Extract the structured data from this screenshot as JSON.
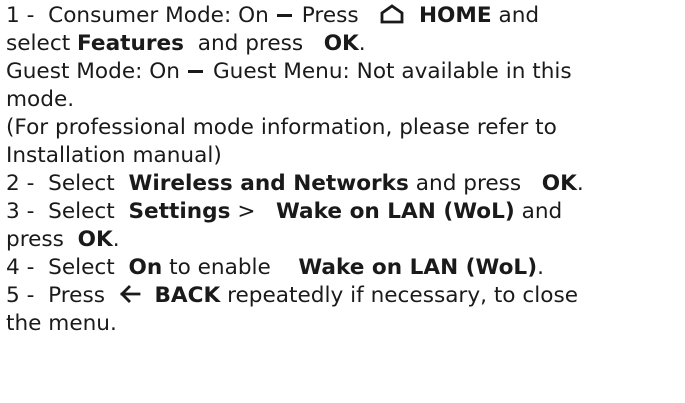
{
  "lines": [
    {
      "step": "1 -",
      "t1": "Consumer Mode: On",
      "t2": "Press",
      "home_icon": "home-icon",
      "home": "HOME",
      "t3": "and"
    },
    {
      "t1": "select",
      "features": "Features",
      "t2": "and press",
      "ok": "OK",
      "t3": "."
    },
    {
      "t1": "Guest Mode: On",
      "t2": "Guest Menu: Not available in this"
    },
    {
      "t1": "mode."
    },
    {
      "t1": "(For professional mode information, please refer to"
    },
    {
      "t1": "Installation manual)"
    },
    {
      "step": "2 -",
      "t1": "Select",
      "wireless": "Wireless and Networks",
      "t2": "and press",
      "ok": "OK",
      "t3": "."
    },
    {
      "step": "3 -",
      "t1": "Select",
      "settings": "Settings",
      "t2": ">",
      "wol": "Wake on LAN (WoL)",
      "t3": "and"
    },
    {
      "t1": "press",
      "ok": "OK",
      "t2": "."
    },
    {
      "step": "4 -",
      "t1": "Select",
      "on": "On",
      "t2": "to enable",
      "wol": "Wake on LAN (WoL)",
      "t3": "."
    },
    {
      "step": "5 -",
      "t1": "Press",
      "back_icon": "back-arrow-icon",
      "back": "BACK",
      "t2": "repeatedly if necessary, to close"
    },
    {
      "t1": "the menu."
    }
  ]
}
